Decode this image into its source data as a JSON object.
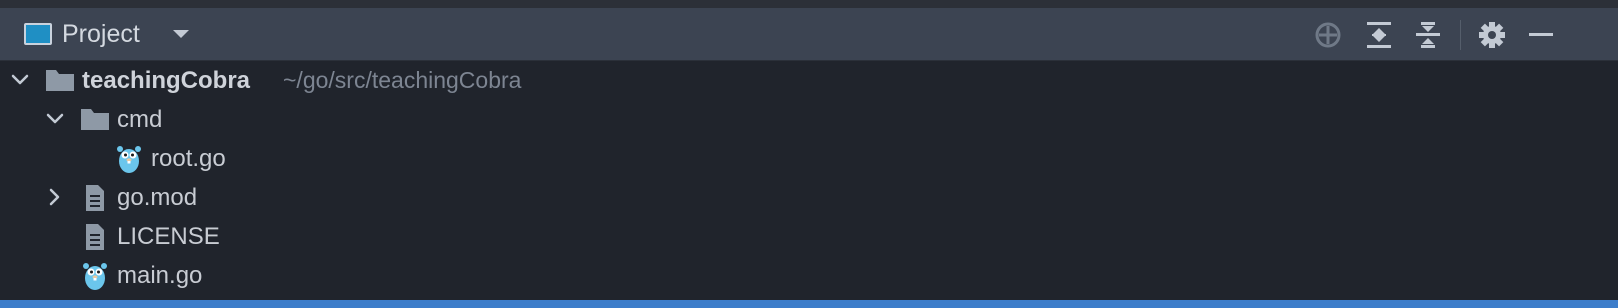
{
  "header": {
    "title": "Project",
    "icons": {
      "view_icon": "project-window-icon",
      "dropdown": "chevron-down-icon",
      "locate": "crosshair-icon",
      "expand_all": "expand-all-icon",
      "collapse_all": "collapse-all-icon",
      "settings": "gear-icon",
      "hide": "minimize-icon"
    }
  },
  "tree": {
    "root": {
      "name": "teachingCobra",
      "path": "~/go/src/teachingCobra",
      "icon": "folder-icon",
      "expanded": true
    },
    "items": [
      {
        "name": "cmd",
        "icon": "folder-icon",
        "expanded": true
      },
      {
        "name": "root.go",
        "icon": "gopher-icon"
      },
      {
        "name": "go.mod",
        "icon": "file-icon",
        "expanded": false
      },
      {
        "name": "LICENSE",
        "icon": "file-icon"
      },
      {
        "name": "main.go",
        "icon": "gopher-icon"
      }
    ]
  },
  "colors": {
    "background": "#20242c",
    "header": "#3c4452",
    "text": "#c8ccd3",
    "muted": "#7d8592",
    "folder": "#8e99a6",
    "gopher": "#6bc6ec",
    "accent": "#3d7dca"
  }
}
